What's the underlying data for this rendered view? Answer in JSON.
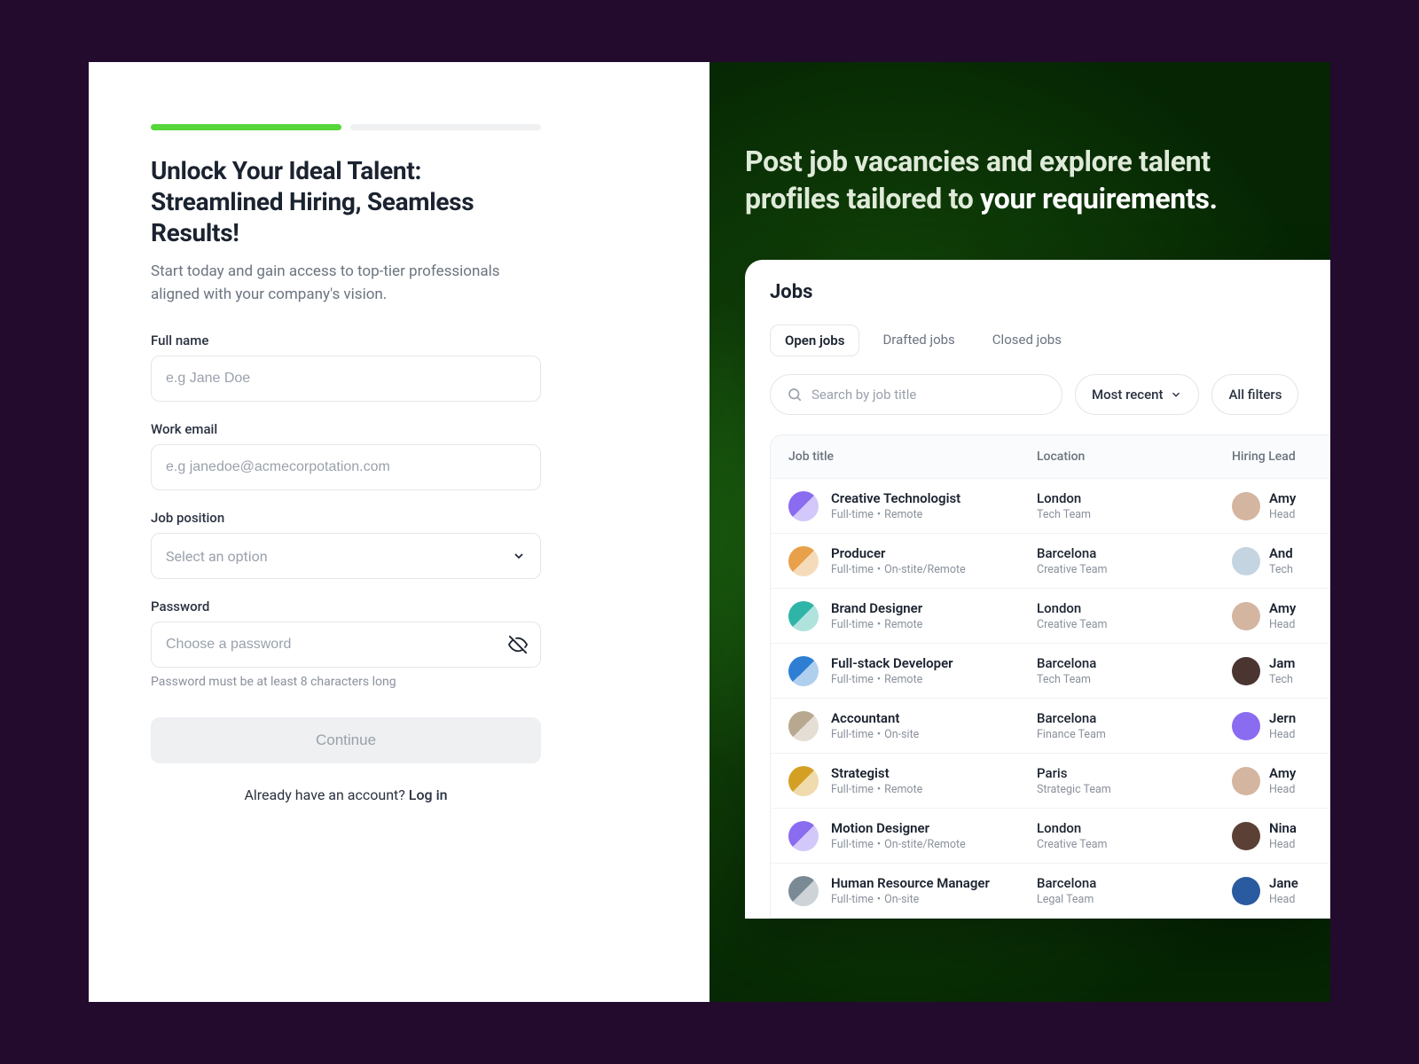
{
  "signup": {
    "title": "Unlock Your Ideal Talent: Streamlined Hiring, Seamless Results!",
    "subtitle": "Start today and gain access to top-tier professionals aligned with your company's vision.",
    "fields": {
      "fullname_label": "Full name",
      "fullname_placeholder": "e.g Jane Doe",
      "email_label": "Work email",
      "email_placeholder": "e.g janedoe@acmecorpotation.com",
      "position_label": "Job position",
      "position_placeholder": "Select an option",
      "password_label": "Password",
      "password_placeholder": "Choose a password",
      "password_hint": "Password must be at least 8 characters long"
    },
    "continue_label": "Continue",
    "login_prompt": "Already have an account? ",
    "login_link": "Log in"
  },
  "hero": {
    "line1": "Post job vacancies and explore talent profiles tailored to ",
    "highlight": "your requirements."
  },
  "jobs": {
    "title": "Jobs",
    "tabs": {
      "open": "Open jobs",
      "drafted": "Drafted jobs",
      "closed": "Closed jobs"
    },
    "search_placeholder": "Search by job title",
    "sort_label": "Most recent",
    "filter_label": "All filters",
    "headers": {
      "title": "Job title",
      "location": "Location",
      "lead": "Hiring Lead"
    },
    "rows": [
      {
        "title": "Creative Technologist",
        "type": "Full-time",
        "mode": "Remote",
        "city": "London",
        "team": "Tech Team",
        "lead": "Amy",
        "role": "Head",
        "icon": "#8a6cf0",
        "avatar": "#d4b5a0"
      },
      {
        "title": "Producer",
        "type": "Full-time",
        "mode": "On-stite/Remote",
        "city": "Barcelona",
        "team": "Creative Team",
        "lead": "And",
        "role": "Tech",
        "icon": "#e8a04a",
        "avatar": "#c4d4e0"
      },
      {
        "title": "Brand Designer",
        "type": "Full-time",
        "mode": "Remote",
        "city": "London",
        "team": "Creative Team",
        "lead": "Amy",
        "role": "Head",
        "icon": "#2fb5a8",
        "avatar": "#d4b5a0"
      },
      {
        "title": "Full-stack Developer",
        "type": "Full-time",
        "mode": "Remote",
        "city": "Barcelona",
        "team": "Tech Team",
        "lead": "Jam",
        "role": "Tech",
        "icon": "#2e7fd4",
        "avatar": "#4a3530"
      },
      {
        "title": "Accountant",
        "type": "Full-time",
        "mode": "On-site",
        "city": "Barcelona",
        "team": "Finance Team",
        "lead": "Jern",
        "role": "Head",
        "icon": "#b8a890",
        "avatar": "#8a6cf0"
      },
      {
        "title": "Strategist",
        "type": "Full-time",
        "mode": "Remote",
        "city": "Paris",
        "team": "Strategic Team",
        "lead": "Amy",
        "role": "Head",
        "icon": "#d4a024",
        "avatar": "#d4b5a0"
      },
      {
        "title": "Motion Designer",
        "type": "Full-time",
        "mode": "On-stite/Remote",
        "city": "London",
        "team": "Creative Team",
        "lead": "Nina",
        "role": "Head",
        "icon": "#8a6cf0",
        "avatar": "#5a4035"
      },
      {
        "title": "Human Resource Manager",
        "type": "Full-time",
        "mode": "On-site",
        "city": "Barcelona",
        "team": "Legal Team",
        "lead": "Jane",
        "role": "Head",
        "icon": "#7a8a94",
        "avatar": "#2a5aa0"
      }
    ]
  }
}
